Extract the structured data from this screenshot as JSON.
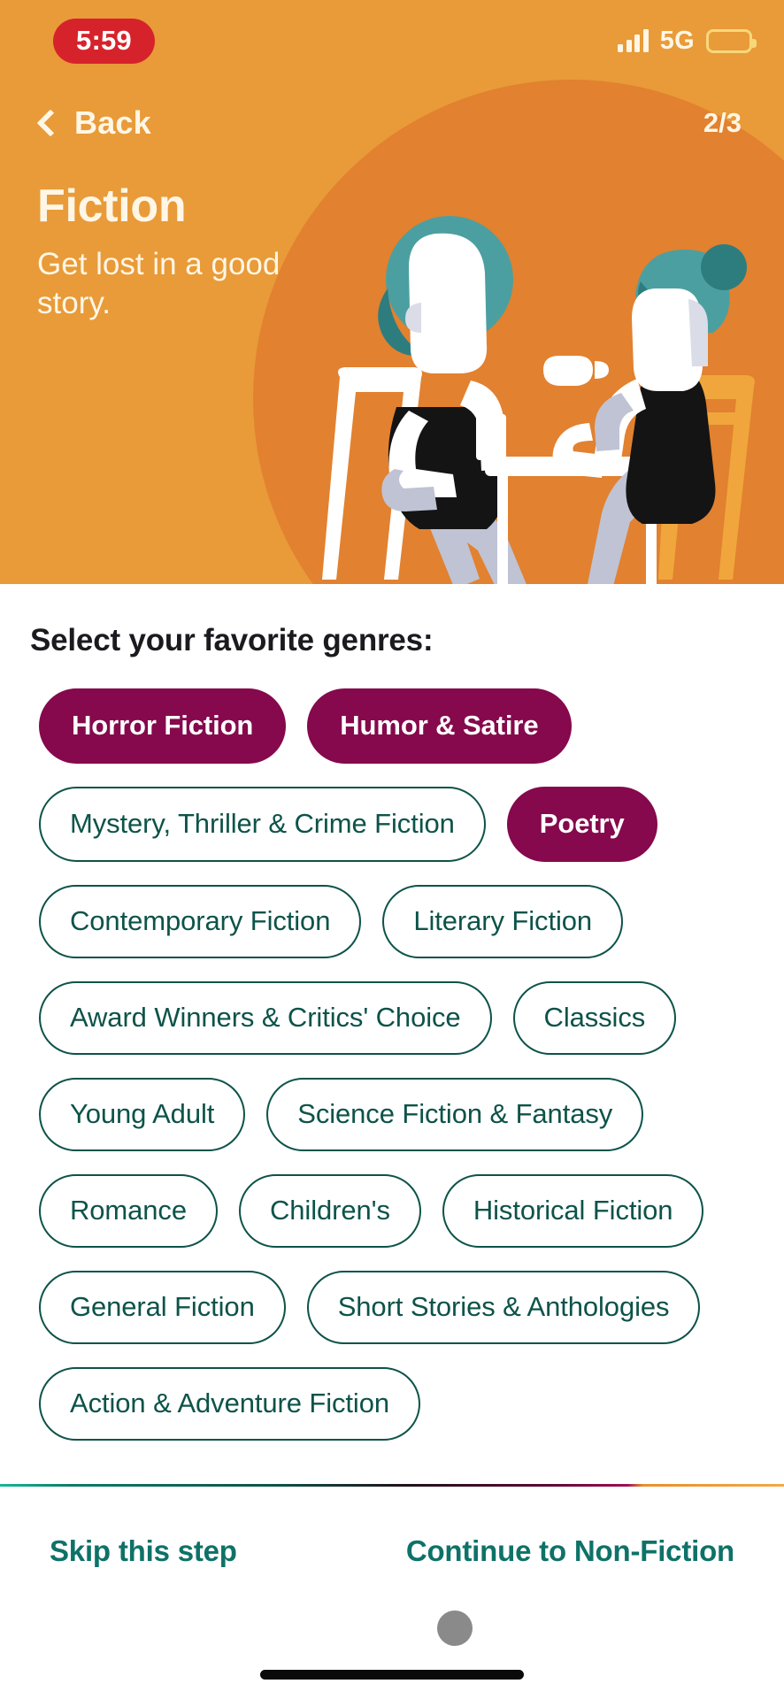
{
  "status_bar": {
    "time": "5:59",
    "network_label": "5G",
    "signal_icon": "signal-bars-icon",
    "battery_icon": "battery-low-power-icon",
    "time_pill_color": "#D6232B",
    "battery_color": "#FFDD00"
  },
  "header": {
    "back_label": "Back",
    "back_icon": "chevron-left-icon",
    "step_indicator": "2/3",
    "title": "Fiction",
    "subtitle": "Get lost in a good story.",
    "background_color": "#E89B38",
    "circle_color": "#E2812F",
    "text_color": "#FFF6E6",
    "illustration": "two-people-at-cafe-table-illustration"
  },
  "main": {
    "section_title": "Select your favorite genres:",
    "selected_color": "#85094C",
    "unselected_color": "#0D5349",
    "genres": [
      {
        "label": "Horror Fiction",
        "selected": true
      },
      {
        "label": "Humor & Satire",
        "selected": true
      },
      {
        "label": "Mystery, Thriller & Crime Fiction",
        "selected": false
      },
      {
        "label": "Poetry",
        "selected": true
      },
      {
        "label": "Contemporary Fiction",
        "selected": false
      },
      {
        "label": "Literary Fiction",
        "selected": false
      },
      {
        "label": "Award Winners & Critics' Choice",
        "selected": false
      },
      {
        "label": "Classics",
        "selected": false
      },
      {
        "label": "Young Adult",
        "selected": false
      },
      {
        "label": "Science Fiction & Fantasy",
        "selected": false
      },
      {
        "label": "Romance",
        "selected": false
      },
      {
        "label": "Children's",
        "selected": false
      },
      {
        "label": "Historical Fiction",
        "selected": false
      },
      {
        "label": "General Fiction",
        "selected": false
      },
      {
        "label": "Short Stories & Anthologies",
        "selected": false
      },
      {
        "label": "Action & Adventure Fiction",
        "selected": false
      }
    ]
  },
  "footer": {
    "skip_label": "Skip this step",
    "continue_label": "Continue to Non-Fiction",
    "link_color": "#0E7268",
    "cursor_indicator": "touch-cursor-dot",
    "home_indicator": "home-indicator-bar"
  }
}
